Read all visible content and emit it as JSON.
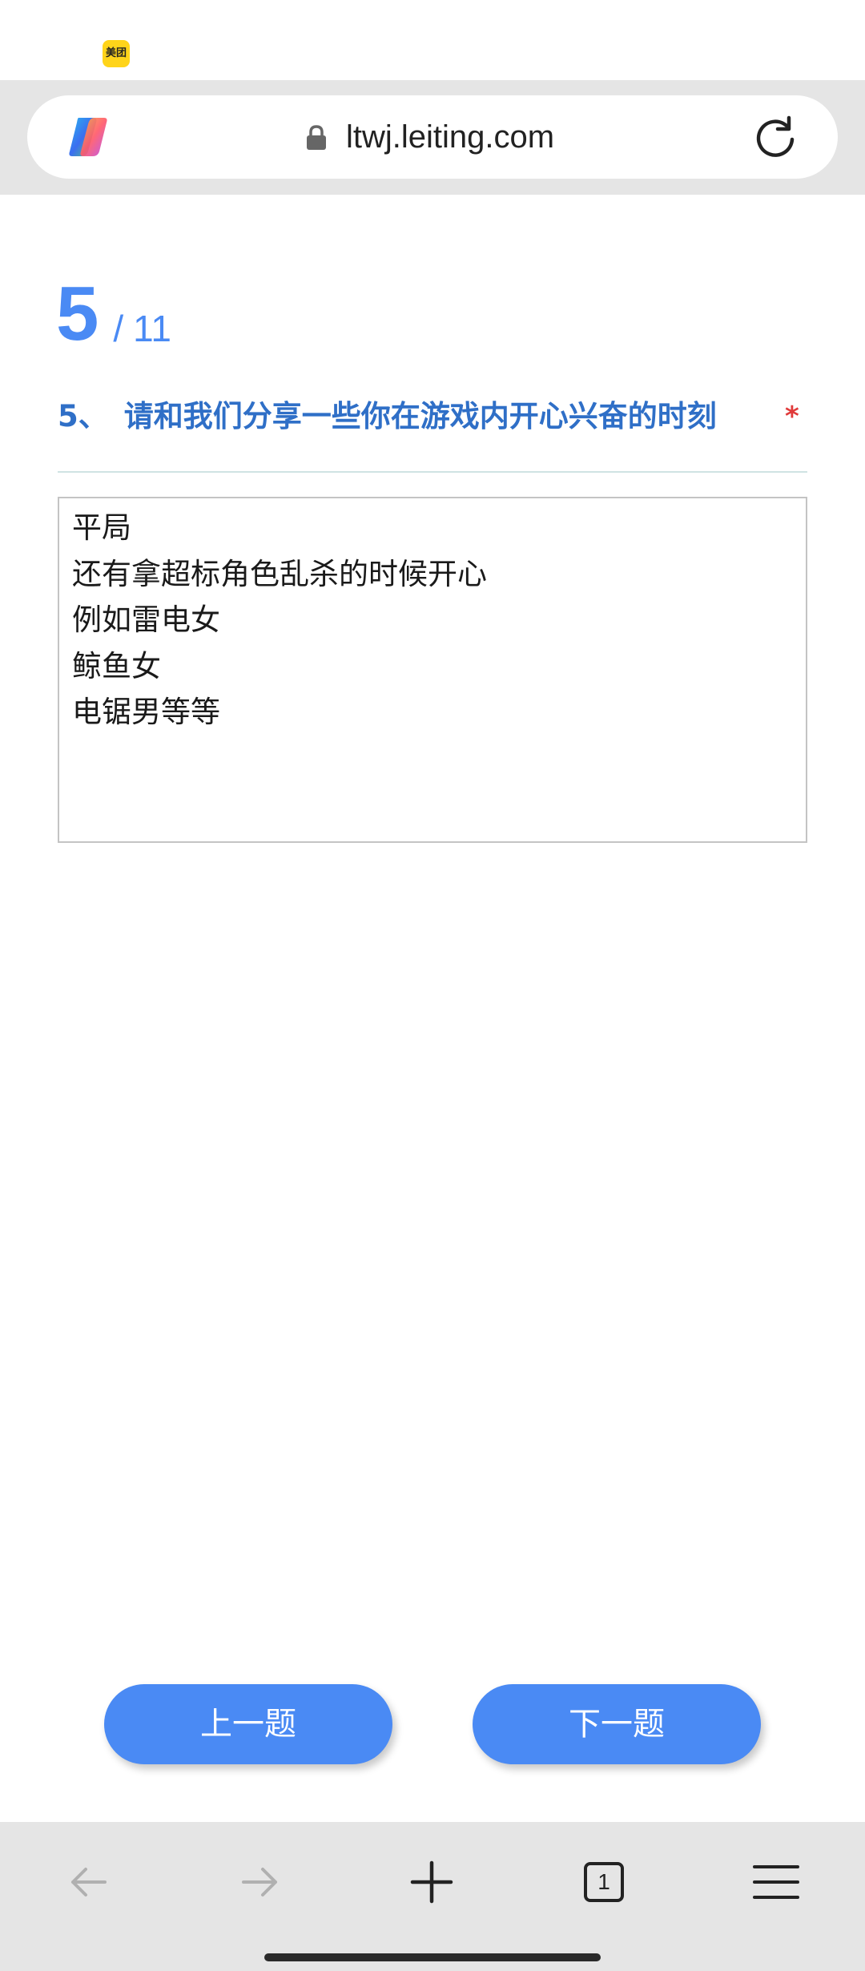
{
  "status_bar": {
    "notification_app": "美团"
  },
  "browser": {
    "url": "ltwj.leiting.com",
    "logo_icon": "copilot-logo",
    "lock_icon": "lock-icon",
    "reload_icon": "reload-icon"
  },
  "survey": {
    "progress": {
      "current": "5",
      "separator": "/",
      "total": "11"
    },
    "question": {
      "number": "5、",
      "text": "请和我们分享一些你在游戏内开心兴奋的时刻",
      "required_mark": "*"
    },
    "answer_lines": [
      "平局",
      "还有拿超标角色乱杀的时候开心",
      "例如雷电女",
      "鲸鱼女",
      "电锯男等等"
    ],
    "prev_label": "上一题",
    "next_label": "下一题"
  },
  "bottom_bar": {
    "tab_count": "1",
    "icons": [
      "back-arrow-icon",
      "forward-arrow-icon",
      "new-tab-plus-icon",
      "tabs-icon",
      "menu-icon"
    ]
  },
  "colors": {
    "accent": "#4a8af4",
    "question": "#2f6fc7",
    "required": "#e03a3a",
    "toolbar": "#e5e5e5"
  }
}
